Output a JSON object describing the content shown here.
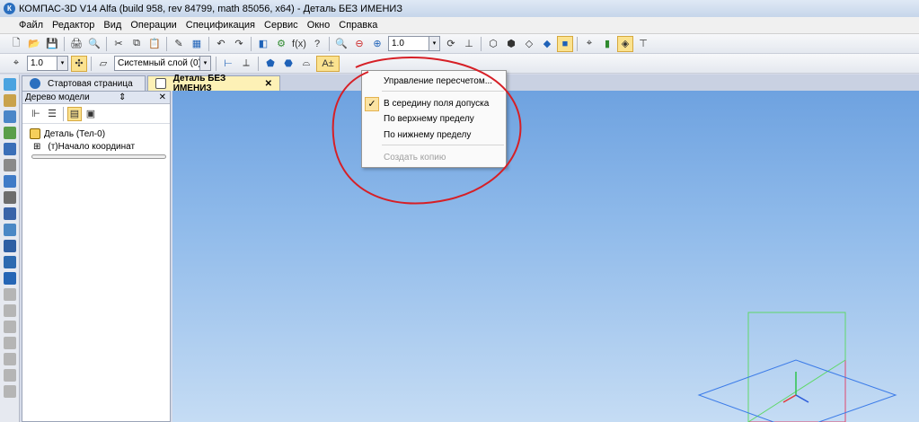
{
  "window": {
    "title": "КОМПАС-3D V14 Alfa (build 958, rev 84799, math 85056, x64) - Деталь БЕЗ ИМЕНИЗ"
  },
  "menu": [
    "Файл",
    "Редактор",
    "Вид",
    "Операции",
    "Спецификация",
    "Сервис",
    "Окно",
    "Справка"
  ],
  "toolbar": {
    "zoom_value": "1.0",
    "step_value": "1.0",
    "layer_value": "Системный слой (0)"
  },
  "tabs": [
    {
      "label": "Стартовая страница"
    },
    {
      "label": "Деталь БЕЗ ИМЕНИЗ",
      "close": "✕"
    }
  ],
  "tree": {
    "header": "Дерево модели",
    "pin": "⇕",
    "close": "✕",
    "root": "Деталь (Тел-0)",
    "child": "(т)Начало координат",
    "expander": "⊞"
  },
  "dropdown": {
    "items": [
      {
        "label": "Управление пересчетом..."
      },
      {
        "label": "В середину поля допуска",
        "checked": true,
        "check": "✓"
      },
      {
        "label": "По верхнему пределу"
      },
      {
        "label": "По нижнему пределу"
      },
      {
        "label": "Создать копию",
        "disabled": true
      }
    ]
  },
  "icons": {
    "app_logo": "К",
    "new": "🗋",
    "open": "📂",
    "save": "💾",
    "print": "🖨",
    "undo": "↶",
    "redo": "↷",
    "zoom": "🔍",
    "rotate": "⟳",
    "help": "?",
    "dropdown_arrow": "▾"
  },
  "colors": {
    "annotation_circle": "#d61f26",
    "viewport_top": "#6ea2e0",
    "accent_active": "#fbe28f"
  }
}
